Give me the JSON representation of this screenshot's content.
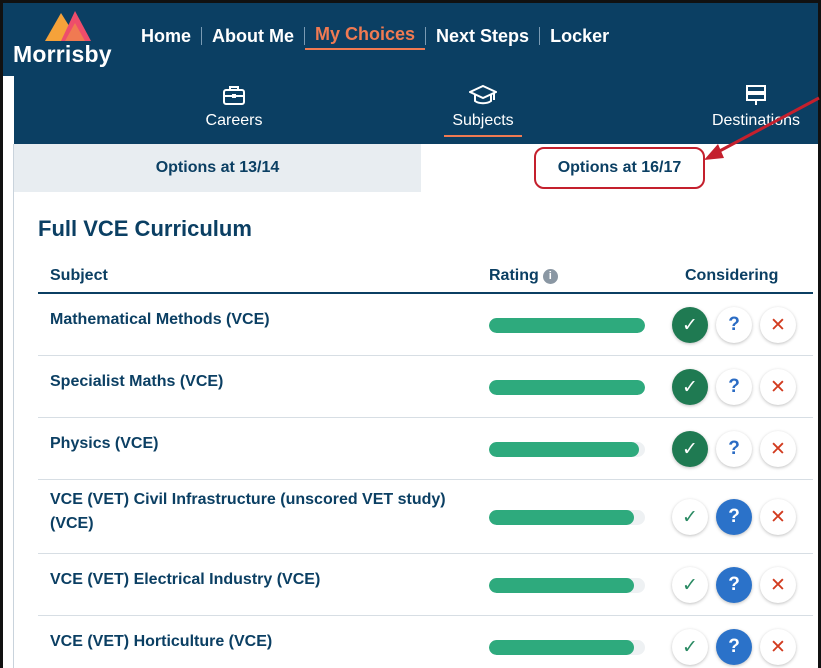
{
  "brand": {
    "name": "Morrisby"
  },
  "nav": {
    "items": [
      {
        "label": "Home",
        "active": false
      },
      {
        "label": "About Me",
        "active": false
      },
      {
        "label": "My Choices",
        "active": true
      },
      {
        "label": "Next Steps",
        "active": false
      },
      {
        "label": "Locker",
        "active": false
      }
    ]
  },
  "subnav": {
    "items": [
      {
        "label": "Careers",
        "icon": "briefcase-icon",
        "active": false
      },
      {
        "label": "Subjects",
        "icon": "graduation-cap-icon",
        "active": true
      },
      {
        "label": "Destinations",
        "icon": "signpost-icon",
        "active": false
      }
    ]
  },
  "tabs": {
    "items": [
      {
        "label": "Options at 13/14",
        "active": false
      },
      {
        "label": "Options at 16/17",
        "active": true
      }
    ]
  },
  "section": {
    "title": "Full VCE Curriculum"
  },
  "table": {
    "headers": {
      "subject": "Subject",
      "rating": "Rating",
      "rating_info": "i",
      "considering": "Considering"
    },
    "rows": [
      {
        "subject": "Mathematical Methods (VCE)",
        "rating": 1.0,
        "selected": "yes"
      },
      {
        "subject": "Specialist Maths (VCE)",
        "rating": 1.0,
        "selected": "yes"
      },
      {
        "subject": "Physics (VCE)",
        "rating": 0.96,
        "selected": "yes"
      },
      {
        "subject": "VCE (VET) Civil Infrastructure (unscored VET study) (VCE)",
        "rating": 0.93,
        "selected": "maybe"
      },
      {
        "subject": "VCE (VET) Electrical Industry (VCE)",
        "rating": 0.93,
        "selected": "maybe"
      },
      {
        "subject": "VCE (VET) Horticulture (VCE)",
        "rating": 0.93,
        "selected": "maybe"
      }
    ]
  },
  "considering_buttons": {
    "yes": "✓",
    "maybe": "?",
    "no": "✕"
  },
  "colors": {
    "header_bg": "#0b3f63",
    "accent": "#f07a52",
    "rating_fill": "#2eaa7d",
    "highlight": "#c4202d",
    "check_on": "#1f7a52",
    "question_on": "#2b72c9",
    "cross": "#d23b1f"
  }
}
